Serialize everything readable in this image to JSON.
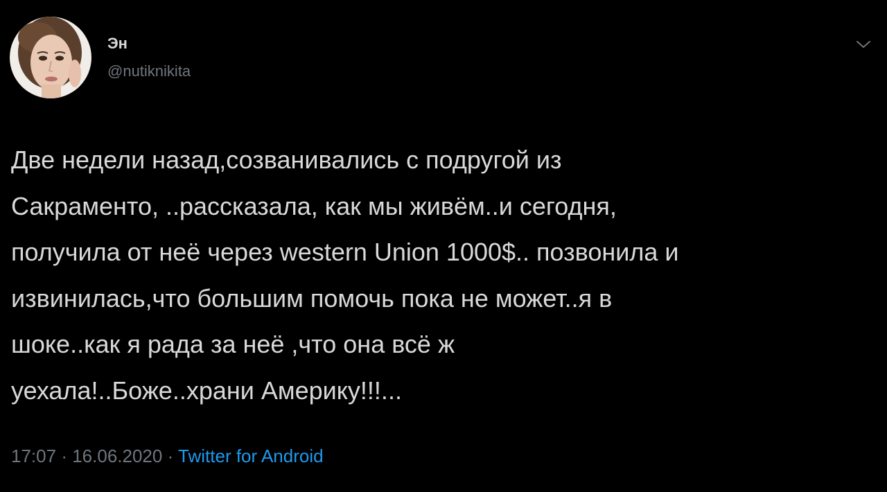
{
  "user": {
    "display_name": "Эн",
    "handle": "@nutiknikita",
    "avatar_icon": "profile-photo"
  },
  "tweet": {
    "lines": [
      "Две недели  назад,созванивались с подругой из",
      "Сакраменто, ..рассказала, как мы живём..и сегодня,",
      "получила от неё через western Union 1000$.. позвонила и",
      "извинилась,что большим помочь пока не может..я в",
      "шоке..как я рада за неё ,что она всё ж",
      "уехала!..Боже..храни Америку!!!..."
    ],
    "time": "17:07",
    "separator": "·",
    "date": "16.06.2020",
    "source": "Twitter for Android"
  },
  "icons": {
    "menu": "chevron-down-icon"
  },
  "colors": {
    "background": "#000000",
    "text": "#d9d9d9",
    "secondary": "#6e767d",
    "link": "#1d9bf0"
  }
}
